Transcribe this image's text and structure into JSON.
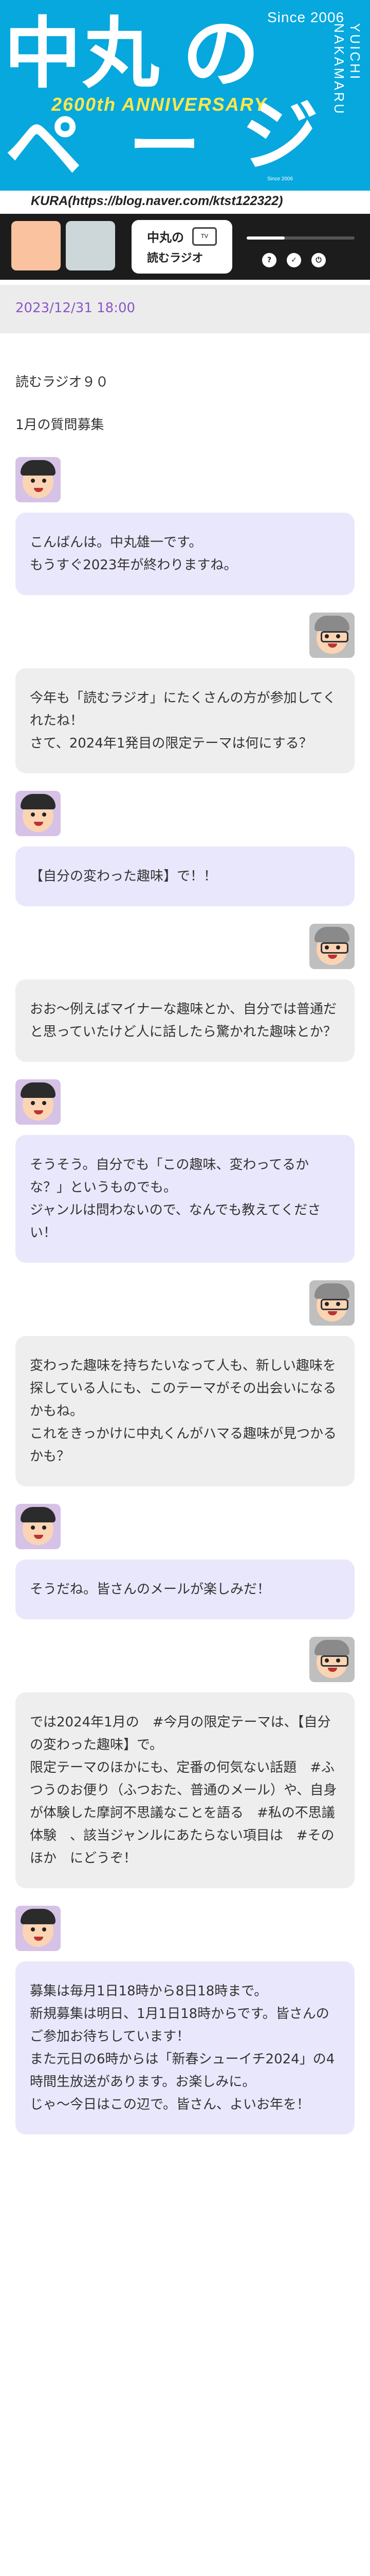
{
  "banner": {
    "title_chars": [
      "中",
      "丸",
      "の",
      "ペ",
      "ー",
      "ジ"
    ],
    "since": "Since 2006",
    "anniversary": "2600th ANNIVERSARY",
    "vertical_name": "YUICHI NAKAMARU",
    "small_since": "Since 2006"
  },
  "credit": "KURA(https://blog.naver.com/ktst122322)",
  "radio": {
    "logo_line1": "中丸の",
    "logo_line2": "読むラジオ",
    "logo_tv": "TV",
    "progress_fraction": 0.35,
    "controls": [
      "?",
      "✓",
      "⏻"
    ]
  },
  "post": {
    "date": "2023/12/31 18:00",
    "title": "読むラジオ９０",
    "subtitle": "1月の質問募集"
  },
  "messages": [
    {
      "side": "left",
      "text": "こんばんは。中丸雄一です。\nもうすぐ2023年が終わりますね。"
    },
    {
      "side": "right",
      "text": "今年も「読むラジオ」にたくさんの方が参加してくれたね！\nさて、2024年1発目の限定テーマは何にする？"
    },
    {
      "side": "left",
      "text": "【自分の変わった趣味】で！！"
    },
    {
      "side": "right",
      "text": "おお～例えばマイナーな趣味とか、自分では普通だと思っていたけど人に話したら驚かれた趣味とか？"
    },
    {
      "side": "left",
      "text": "そうそう。自分でも「この趣味、変わってるかな？」というものでも。\nジャンルは問わないので、なんでも教えてください！"
    },
    {
      "side": "right",
      "text": "変わった趣味を持ちたいなって人も、新しい趣味を探している人にも、このテーマがその出会いになるかもね。\nこれをきっかけに中丸くんがハマる趣味が見つかるかも？"
    },
    {
      "side": "left",
      "text": "そうだね。皆さんのメールが楽しみだ！"
    },
    {
      "side": "right",
      "text": "では2024年1月の　#今月の限定テーマは、【自分の変わった趣味】で。\n限定テーマのほかにも、定番の何気ない話題　#ふつうのお便り（ふつおた、普通のメール）や、自身が体験した摩訶不思議なことを語る　#私の不思議体験　、該当ジャンルにあたらない項目は　#そのほか　にどうぞ！"
    },
    {
      "side": "left",
      "text": "募集は毎月1日18時から8日18時まで。\n新規募集は明日、1月1日18時からです。皆さんのご参加お待ちしています！\nまた元日の6時からは「新春シューイチ2024」の4時間生放送があります。お楽しみに。\nじゃ～今日はこの辺で。皆さん、よいお年を！"
    }
  ]
}
